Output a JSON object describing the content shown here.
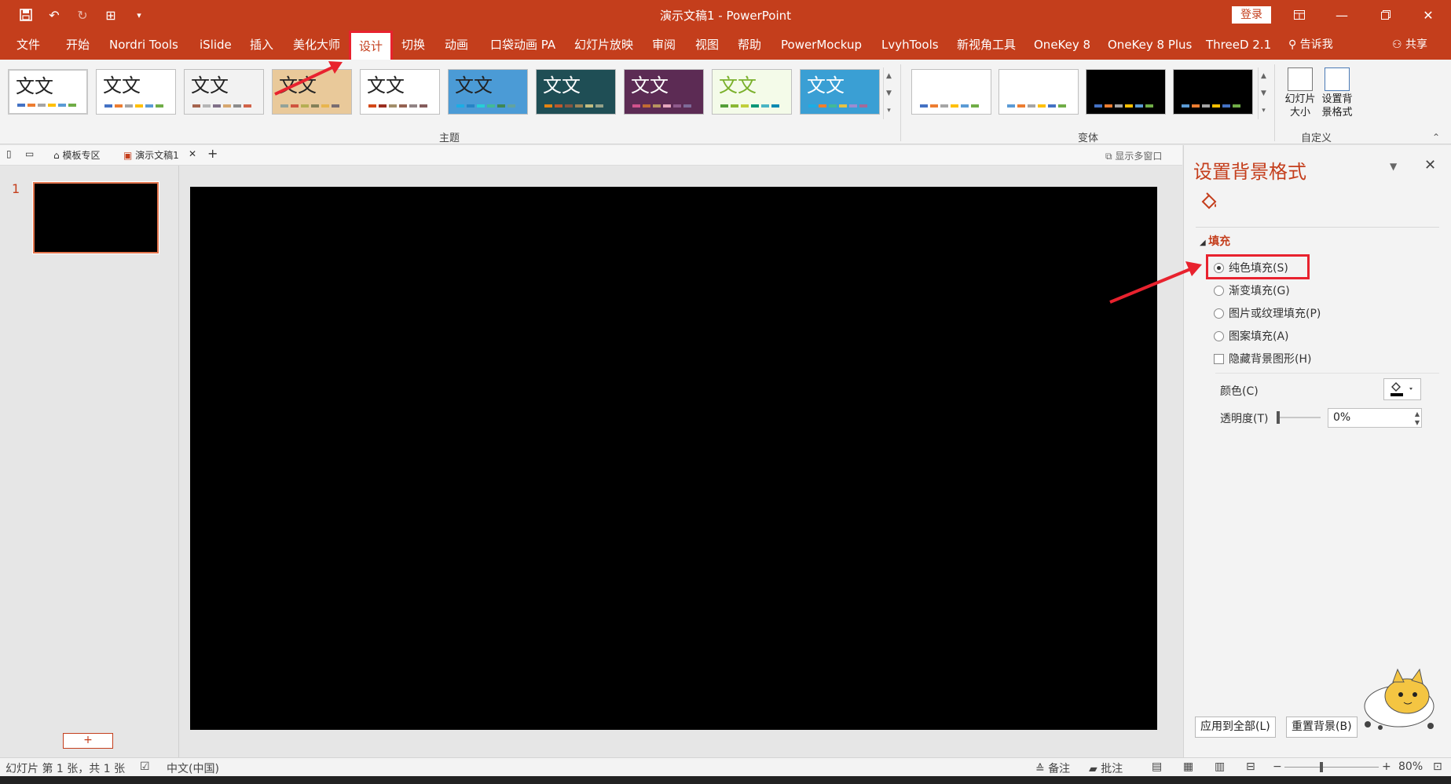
{
  "window": {
    "title": "演示文稿1  -  PowerPoint",
    "login_label": "登录",
    "controls": [
      "ribbon-display-icon",
      "minimize-icon",
      "maximize-icon",
      "close-icon"
    ]
  },
  "qat": {
    "icons": [
      "save-icon",
      "undo-icon",
      "redo-icon",
      "present-icon",
      "customize-icon"
    ]
  },
  "menu": {
    "tabs": [
      {
        "label": "文件"
      },
      {
        "label": "开始"
      },
      {
        "label": "Nordri Tools"
      },
      {
        "label": "iSlide"
      },
      {
        "label": "插入"
      },
      {
        "label": "美化大师"
      },
      {
        "label": "设计",
        "active": true
      },
      {
        "label": "切换"
      },
      {
        "label": "动画"
      },
      {
        "label": "口袋动画 PA"
      },
      {
        "label": "幻灯片放映"
      },
      {
        "label": "审阅"
      },
      {
        "label": "视图"
      },
      {
        "label": "帮助"
      },
      {
        "label": "PowerMockup"
      },
      {
        "label": "LvyhTools"
      },
      {
        "label": "新视角工具"
      },
      {
        "label": "OneKey 8"
      },
      {
        "label": "OneKey 8 Plus"
      },
      {
        "label": "ThreeD 2.1"
      }
    ],
    "tell_me": "告诉我",
    "share": "共享"
  },
  "ribbon": {
    "themes_group_label": "主题",
    "variants_group_label": "变体",
    "custom_group_label": "自定义",
    "theme_text": "文文",
    "themes": [
      {
        "bg": "#ffffff",
        "text_color": "#222222",
        "bars": [
          "#4472c4",
          "#ed7d31",
          "#a5a5a5",
          "#ffc000",
          "#5b9bd5",
          "#70ad47"
        ]
      },
      {
        "bg": "#ffffff",
        "text_color": "#222222",
        "bars": [
          "#4472c4",
          "#ed7d31",
          "#a5a5a5",
          "#ffc000",
          "#5b9bd5",
          "#70ad47"
        ]
      },
      {
        "bg": "#f2f2f2",
        "text_color": "#222222",
        "bars": [
          "#a5644e",
          "#b5b5b5",
          "#7f6f87",
          "#d6a76f",
          "#8c8c8c",
          "#d16349"
        ]
      },
      {
        "bg": "#e9c99a",
        "text_color": "#222222",
        "bars": [
          "#93a299",
          "#cf543f",
          "#b5ae53",
          "#848058",
          "#e8b54d",
          "#786c71"
        ]
      },
      {
        "bg": "#ffffff",
        "text_color": "#222222",
        "bars": [
          "#d34817",
          "#9b2d1f",
          "#a28e6a",
          "#956251",
          "#918485",
          "#855d5d"
        ]
      },
      {
        "bg": "#4b9bd6",
        "text_color": "#222222",
        "bars": [
          "#1cade4",
          "#2683c6",
          "#27ced7",
          "#42ba97",
          "#3e8853",
          "#62a39f"
        ]
      },
      {
        "bg": "#1f4e55",
        "text_color": "#ffffff",
        "bars": [
          "#e48312",
          "#bd582c",
          "#865640",
          "#9b8357",
          "#c2bc80",
          "#94a088"
        ]
      },
      {
        "bg": "#5c2b54",
        "text_color": "#ffffff",
        "bars": [
          "#d0528c",
          "#c06b33",
          "#b8945f",
          "#e5a6bd",
          "#8f5b8c",
          "#7d6a98"
        ]
      },
      {
        "bg": "#f4fbe9",
        "text_color": "#7ab02c",
        "bars": [
          "#549e39",
          "#8ab833",
          "#c0cf3a",
          "#029676",
          "#4ab5c4",
          "#0989b1"
        ]
      },
      {
        "bg": "#3a9fd4",
        "text_color": "#ffffff",
        "bars": [
          "#1cade4",
          "#f57f2a",
          "#42ba97",
          "#e5c243",
          "#9b8cd1",
          "#a46a9a"
        ]
      }
    ],
    "variants": [
      {
        "bg": "#ffffff",
        "bars": [
          "#4472c4",
          "#ed7d31",
          "#a5a5a5",
          "#ffc000",
          "#5b9bd5",
          "#70ad47"
        ]
      },
      {
        "bg": "#ffffff",
        "bars": [
          "#5b9bd5",
          "#ed7d31",
          "#a5a5a5",
          "#ffc000",
          "#4472c4",
          "#70ad47"
        ]
      },
      {
        "bg": "#000000",
        "bars": [
          "#4472c4",
          "#ed7d31",
          "#a5a5a5",
          "#ffc000",
          "#5b9bd5",
          "#70ad47"
        ]
      },
      {
        "bg": "#000000",
        "bars": [
          "#5b9bd5",
          "#ed7d31",
          "#a5a5a5",
          "#ffc000",
          "#4472c4",
          "#70ad47"
        ]
      }
    ],
    "slide_size_label": "幻灯片大小",
    "format_bg_label": "设置背景格式"
  },
  "doctabs": {
    "template_label": "模板专区",
    "doc_label": "演示文稿1",
    "multi_window": "显示多窗口"
  },
  "thumbnails": {
    "slide_number": "1",
    "add_label": "+"
  },
  "pane": {
    "title": "设置背景格式",
    "section_label": "填充",
    "options": [
      {
        "label": "纯色填充(S)",
        "type": "radio",
        "checked": true
      },
      {
        "label": "渐变填充(G)",
        "type": "radio",
        "checked": false
      },
      {
        "label": "图片或纹理填充(P)",
        "type": "radio",
        "checked": false
      },
      {
        "label": "图案填充(A)",
        "type": "radio",
        "checked": false
      },
      {
        "label": "隐藏背景图形(H)",
        "type": "checkbox",
        "checked": false
      }
    ],
    "color_label": "颜色(C)",
    "transparency_label": "透明度(T)",
    "transparency_value": "0%",
    "apply_all_label": "应用到全部(L)",
    "reset_label": "重置背景(B)"
  },
  "status": {
    "slide_info": "幻灯片 第 1 张，共 1 张",
    "language": "中文(中国)",
    "notes": "备注",
    "comments": "批注",
    "zoom": "80%"
  },
  "colors": {
    "accent": "#c43e1c",
    "highlight": "#e8222e",
    "slide_bg": "#000000"
  }
}
